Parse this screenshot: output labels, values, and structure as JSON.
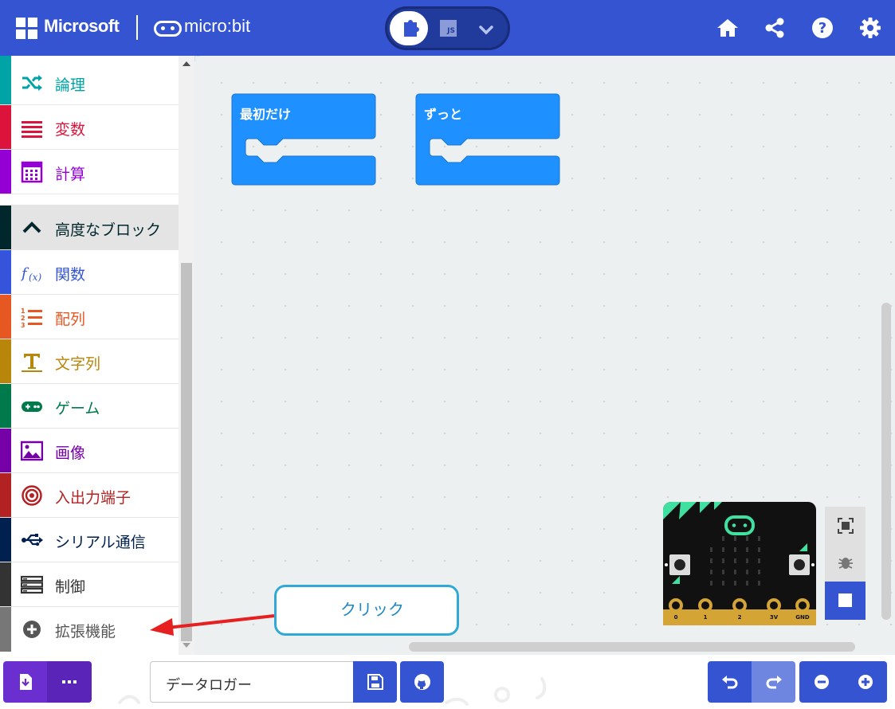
{
  "header": {
    "brand": "Microsoft",
    "product": "micro:bit",
    "editor_js_label": "JS",
    "icons": [
      "home-icon",
      "share-icon",
      "help-icon",
      "settings-icon"
    ]
  },
  "sidebar": {
    "items": [
      {
        "label": "論理",
        "color": "#00a4a6",
        "icon": "shuffle-icon"
      },
      {
        "label": "変数",
        "color": "#dc143c",
        "icon": "variables-icon"
      },
      {
        "label": "計算",
        "color": "#9400d3",
        "icon": "calculator-icon"
      },
      {
        "label": "高度なブロック",
        "color": "#00272b",
        "icon": "chevron-up-icon"
      },
      {
        "label": "関数",
        "color": "#3455db",
        "icon": "function-icon"
      },
      {
        "label": "配列",
        "color": "#e65722",
        "icon": "list-icon"
      },
      {
        "label": "文字列",
        "color": "#b8860b",
        "icon": "text-icon"
      },
      {
        "label": "ゲーム",
        "color": "#007a4b",
        "icon": "gamepad-icon"
      },
      {
        "label": "画像",
        "color": "#7600a8",
        "icon": "image-icon"
      },
      {
        "label": "入出力端子",
        "color": "#b22222",
        "icon": "target-icon"
      },
      {
        "label": "シリアル通信",
        "color": "#002050",
        "icon": "usb-icon"
      },
      {
        "label": "制御",
        "color": "#333333",
        "icon": "control-icon"
      },
      {
        "label": "拡張機能",
        "color": "#777777",
        "icon": "plus-circle-icon"
      }
    ]
  },
  "workspace": {
    "blocks": [
      {
        "label": "最初だけ",
        "color": "#1e90ff"
      },
      {
        "label": "ずっと",
        "color": "#1e90ff"
      }
    ]
  },
  "simulator": {
    "pin_labels": [
      "0",
      "1",
      "2",
      "3V",
      "GND"
    ],
    "button_a": "A",
    "button_b": "B",
    "controls": [
      "fullscreen-icon",
      "debug-icon",
      "stop-icon"
    ]
  },
  "callout": {
    "text": "クリック"
  },
  "footer": {
    "project_name": "データロガー",
    "buttons": [
      "download-icon",
      "more-icon",
      "save-icon",
      "github-icon",
      "undo-icon",
      "redo-icon",
      "zoom-out-icon",
      "zoom-in-icon"
    ]
  },
  "colors": {
    "header": "#3454d1",
    "download": "#6c2fcf",
    "footer_blue": "#3454d1",
    "callout_border": "#31a9d6",
    "arrow": "#e62020"
  }
}
